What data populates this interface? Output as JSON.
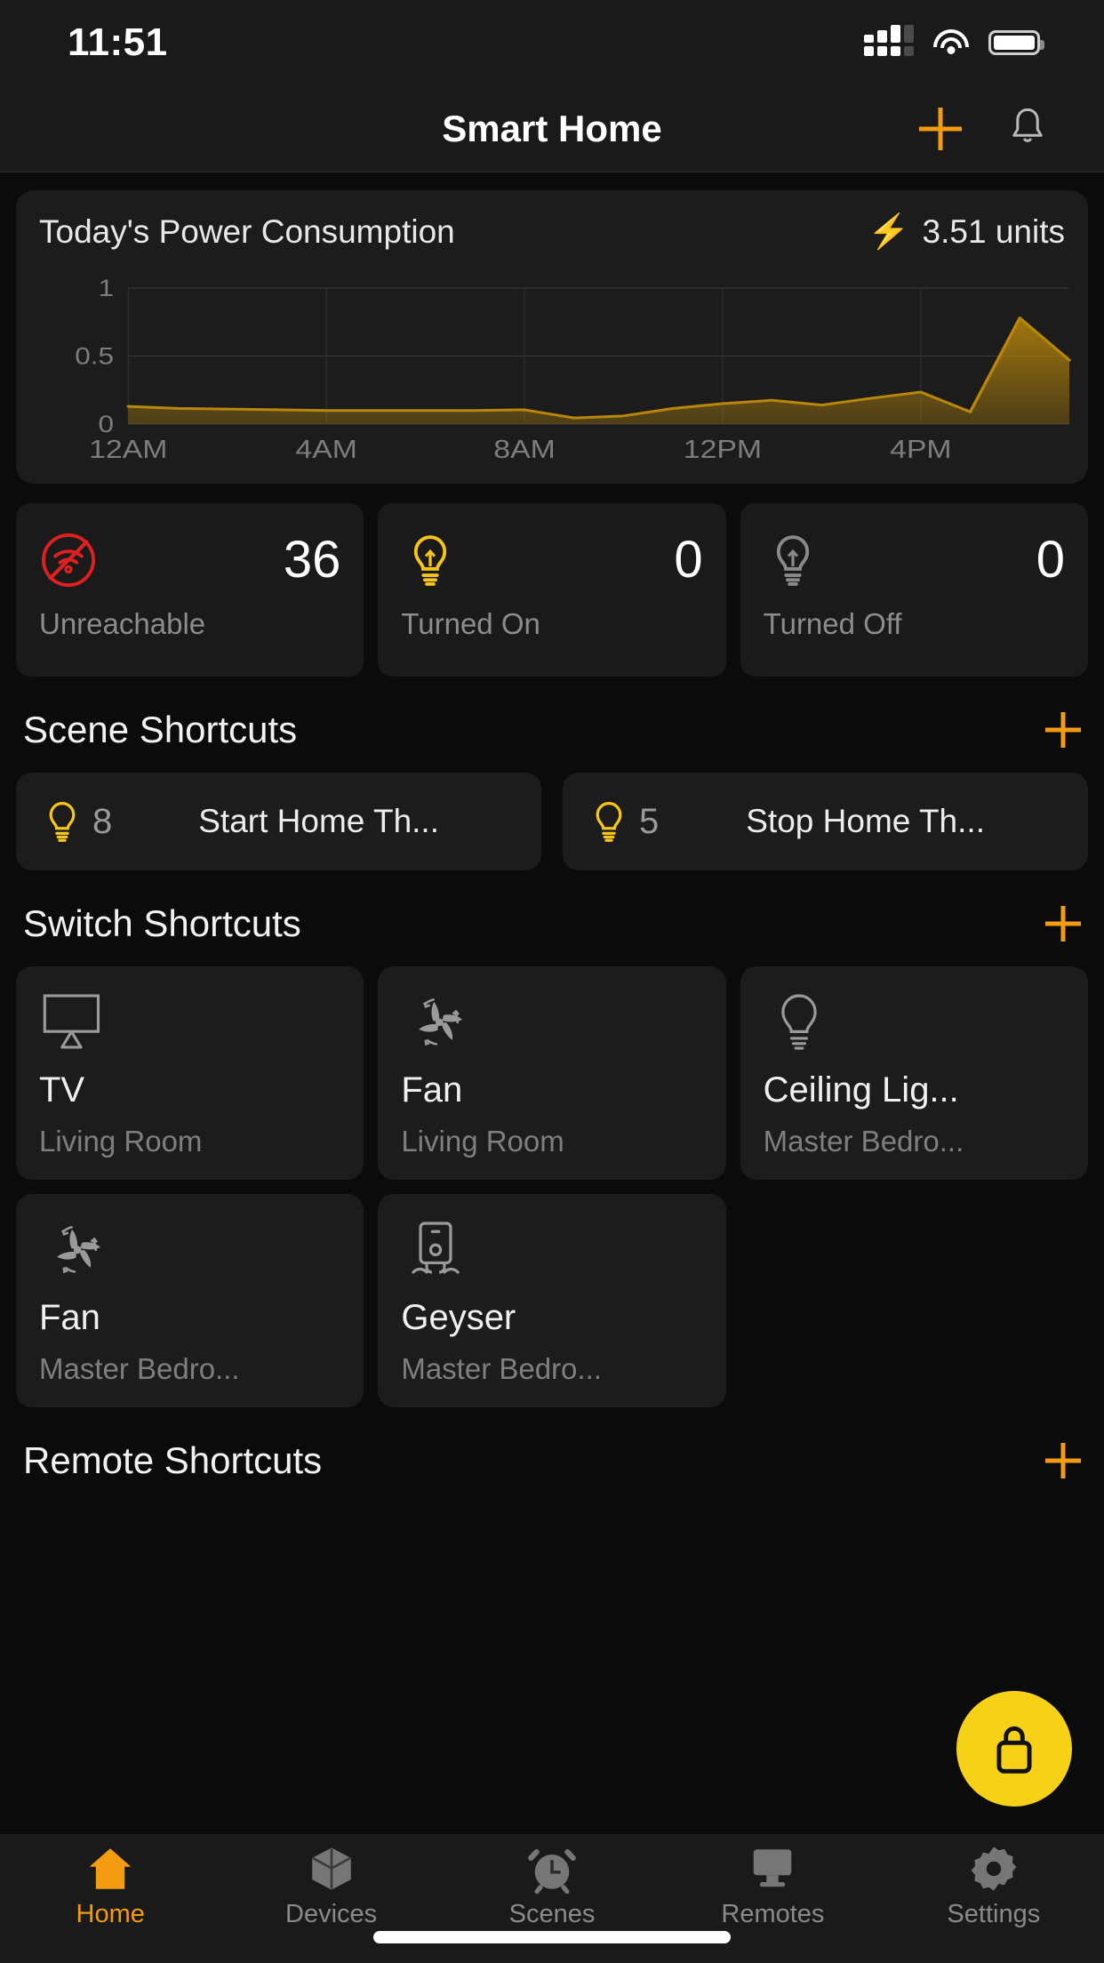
{
  "status_bar": {
    "time": "11:51",
    "cellular_icon": "cellular-signal-icon",
    "wifi_icon": "wifi-icon",
    "battery_icon": "battery-full-icon"
  },
  "nav": {
    "title": "Smart Home",
    "add_icon": "plus-icon",
    "notification_icon": "bell-icon"
  },
  "power_card": {
    "title": "Today's Power Consumption",
    "bolt_icon": "lightning-bolt-icon",
    "units_value": "3.51 units",
    "accent_color": "#b8860b"
  },
  "chart_data": {
    "type": "area",
    "title": "Today's Power Consumption",
    "xlabel": "",
    "ylabel": "",
    "ylim": [
      0,
      1
    ],
    "yticks": [
      "0",
      "0.5",
      "1"
    ],
    "ytick_values": [
      0,
      0.5,
      1
    ],
    "xticks": [
      "12AM",
      "4AM",
      "8AM",
      "12PM",
      "4PM"
    ],
    "xtick_hours": [
      0,
      4,
      8,
      12,
      16
    ],
    "grid": true,
    "legend": "none",
    "line_color": "#b8860b",
    "fill_color": "#b8860b",
    "x": [
      0,
      1,
      2,
      3,
      4,
      5,
      6,
      7,
      8,
      9,
      10,
      11,
      12,
      13,
      14,
      15,
      16,
      17,
      18,
      19
    ],
    "values": [
      0.13,
      0.115,
      0.11,
      0.105,
      0.1,
      0.1,
      0.1,
      0.1,
      0.105,
      0.045,
      0.06,
      0.115,
      0.15,
      0.175,
      0.14,
      0.19,
      0.235,
      0.09,
      0.78,
      0.47
    ],
    "total": 3.51,
    "units": "units"
  },
  "stats": [
    {
      "icon": "wifi-off-icon",
      "icon_color": "#e02020",
      "value": "36",
      "label": "Unreachable"
    },
    {
      "icon": "bulb-on-icon",
      "icon_color": "#f5c518",
      "value": "0",
      "label": "Turned On"
    },
    {
      "icon": "bulb-off-icon",
      "icon_color": "#8a8a8a",
      "value": "0",
      "label": "Turned Off"
    }
  ],
  "scene_section": {
    "title": "Scene Shortcuts",
    "add_icon": "plus-icon",
    "items": [
      {
        "icon": "bulb-icon",
        "count": "8",
        "name": "Start Home Th..."
      },
      {
        "icon": "bulb-icon",
        "count": "5",
        "name": "Stop Home Th..."
      }
    ]
  },
  "switch_section": {
    "title": "Switch Shortcuts",
    "add_icon": "plus-icon",
    "items": [
      {
        "icon": "tv-icon",
        "name": "TV",
        "room": "Living Room"
      },
      {
        "icon": "fan-icon",
        "name": "Fan",
        "room": "Living Room"
      },
      {
        "icon": "bulb-icon",
        "name": "Ceiling Lig...",
        "room": "Master Bedro..."
      },
      {
        "icon": "fan-icon",
        "name": "Fan",
        "room": "Master Bedro..."
      },
      {
        "icon": "geyser-icon",
        "name": "Geyser",
        "room": "Master Bedro..."
      }
    ]
  },
  "remote_section": {
    "title": "Remote Shortcuts",
    "add_icon": "plus-icon"
  },
  "fab": {
    "icon": "lock-icon",
    "background_color": "#f7d117"
  },
  "tabs": [
    {
      "icon": "home-icon",
      "label": "Home",
      "active": true
    },
    {
      "icon": "devices-icon",
      "label": "Devices",
      "active": false
    },
    {
      "icon": "scenes-icon",
      "label": "Scenes",
      "active": false
    },
    {
      "icon": "remotes-icon",
      "label": "Remotes",
      "active": false
    },
    {
      "icon": "settings-icon",
      "label": "Settings",
      "active": false
    }
  ]
}
